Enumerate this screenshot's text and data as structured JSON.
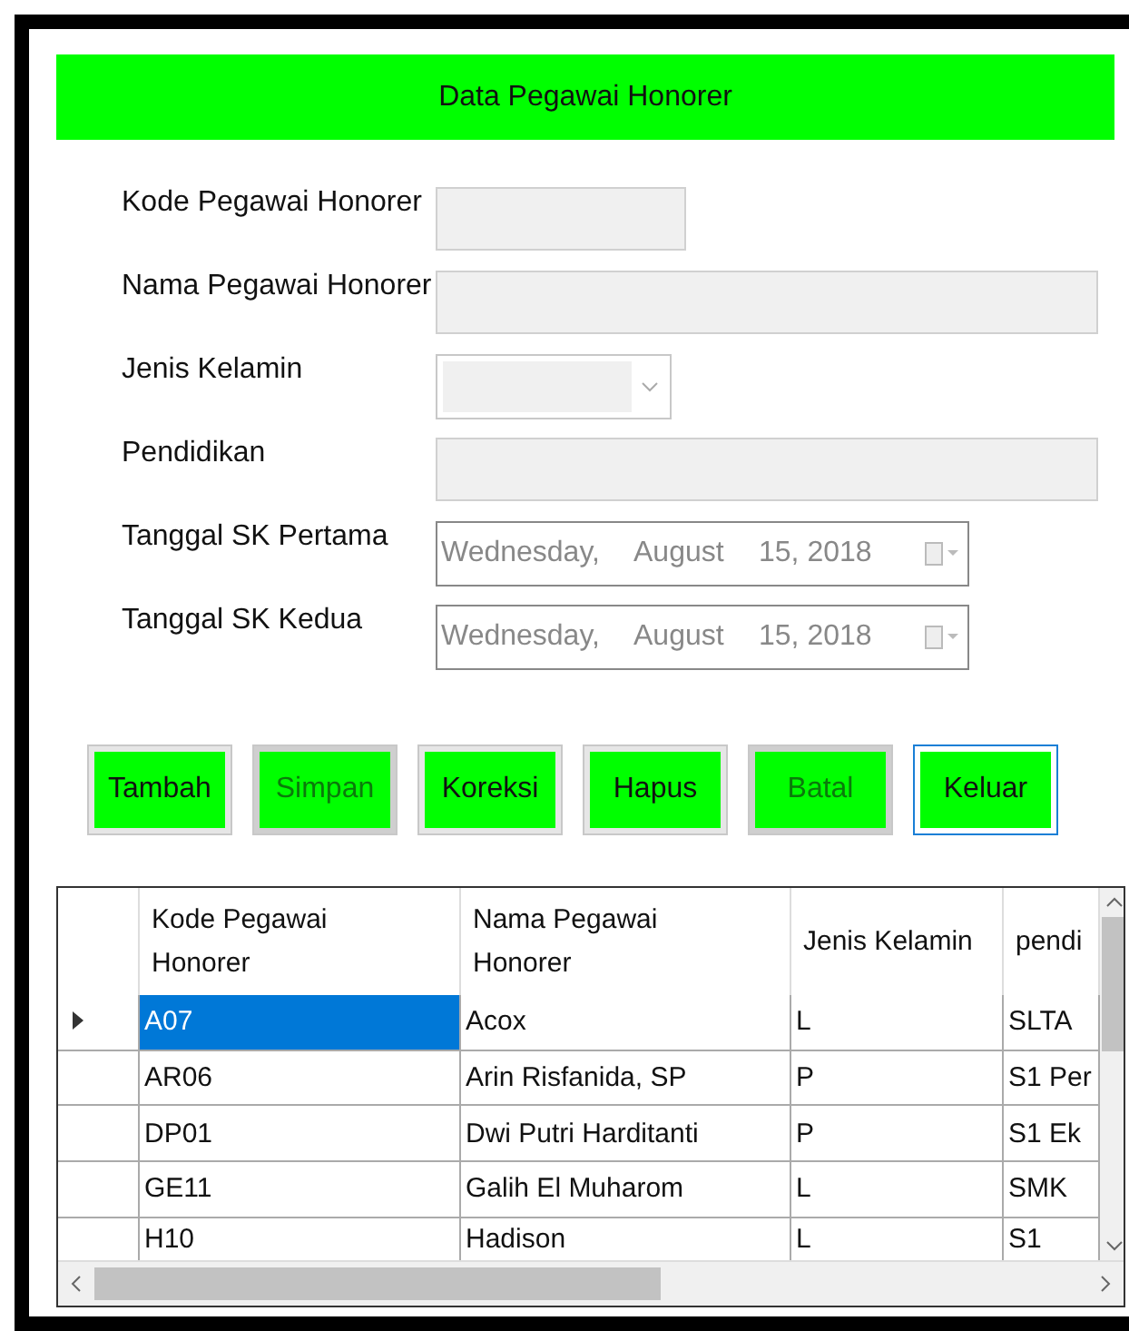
{
  "header": {
    "title": "Data Pegawai Honorer"
  },
  "form": [
    {
      "kind": "short",
      "label": "Kode Pegawai Honorer"
    },
    {
      "kind": "long",
      "label": "Nama Pegawai Honorer"
    },
    {
      "kind": "combo",
      "label": "Jenis Kelamin"
    },
    {
      "kind": "long",
      "label": "Pendidikan"
    },
    {
      "kind": "date",
      "label": "Tanggal SK Pertama",
      "day": "Wednesday,",
      "month": "August",
      "date": "15, 2018"
    },
    {
      "kind": "date",
      "label": "Tanggal SK Kedua",
      "day": "Wednesday,",
      "month": "August",
      "date": "15, 2018"
    }
  ],
  "buttons": [
    {
      "label": "Tambah",
      "disabled": false,
      "focused": false
    },
    {
      "label": "Simpan",
      "disabled": true,
      "focused": false
    },
    {
      "label": "Koreksi",
      "disabled": false,
      "focused": false
    },
    {
      "label": "Hapus",
      "disabled": false,
      "focused": false
    },
    {
      "label": "Batal",
      "disabled": true,
      "focused": false
    },
    {
      "label": "Keluar",
      "disabled": false,
      "focused": true
    }
  ],
  "table": {
    "columns": [
      "Kode Pegawai Honorer",
      "Nama Pegawai Honorer",
      "Jenis Kelamin",
      "pendi"
    ],
    "rows": [
      {
        "selected": true,
        "cells": [
          "A07",
          "Acox",
          "L",
          "SLTA"
        ]
      },
      {
        "selected": false,
        "cells": [
          "AR06",
          "Arin Risfanida, SP",
          "P",
          "S1 Per"
        ]
      },
      {
        "selected": false,
        "cells": [
          "DP01",
          "Dwi Putri Harditanti",
          "P",
          "S1 Ek"
        ]
      },
      {
        "selected": false,
        "cells": [
          "GE11",
          "Galih El Muharom",
          "L",
          "SMK"
        ]
      },
      {
        "selected": false,
        "cells": [
          "H10",
          "Hadison",
          "L",
          "S1"
        ]
      }
    ]
  }
}
